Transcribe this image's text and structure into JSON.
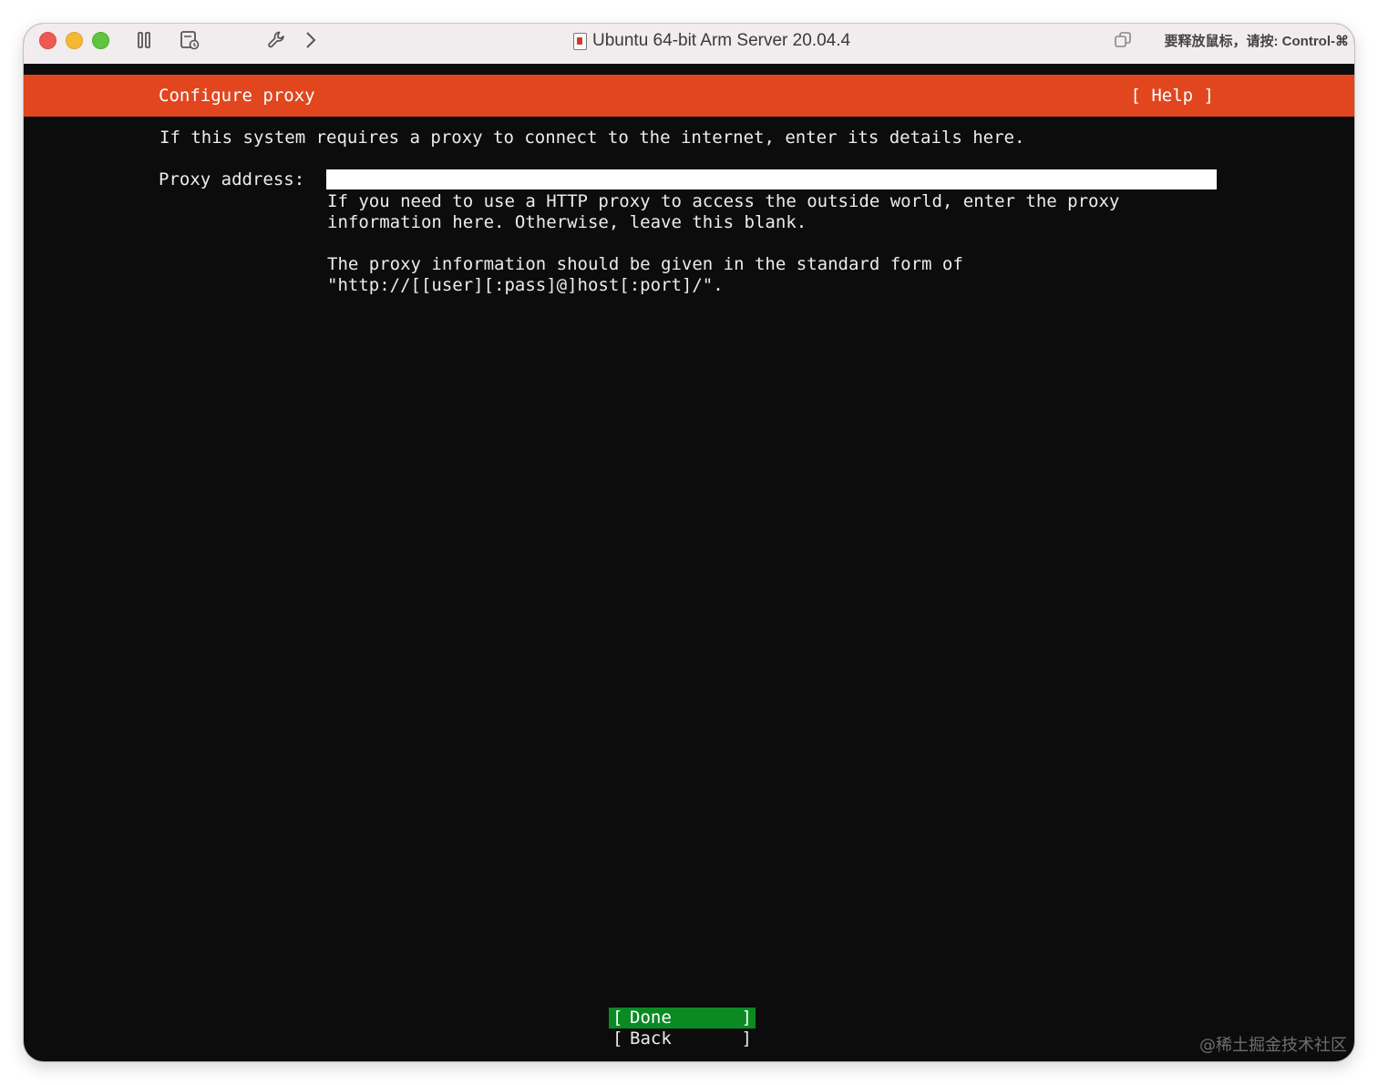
{
  "window": {
    "title": "Ubuntu 64-bit Arm Server 20.04.4",
    "release_hint": "要释放鼠标，请按: Control-⌘",
    "toolbar_icons": [
      "pause-icon",
      "snapshot-icon",
      "wrench-icon",
      "chevron-right-icon",
      "restore-window-icon"
    ]
  },
  "installer": {
    "header_title": "Configure proxy",
    "help_label": "[ Help ]",
    "intro": "If this system requires a proxy to connect to the internet, enter its details here.",
    "proxy_label": "Proxy address:",
    "proxy_value": "",
    "help_lines": [
      "If you need to use a HTTP proxy to access the outside world, enter the proxy",
      "information here. Otherwise, leave this blank.",
      "",
      "The proxy information should be given in the standard form of",
      "\"http://[[user][:pass]@]host[:port]/\"."
    ],
    "buttons": {
      "done_label": "Done",
      "back_label": "Back",
      "left_bracket": "[",
      "right_bracket": "]"
    }
  },
  "watermark": "@稀土掘金技术社区",
  "colors": {
    "header_bar": "#e1461e",
    "terminal_bg": "#0c0c0c",
    "selected_button": "#0b8a24",
    "text": "#ececec"
  }
}
